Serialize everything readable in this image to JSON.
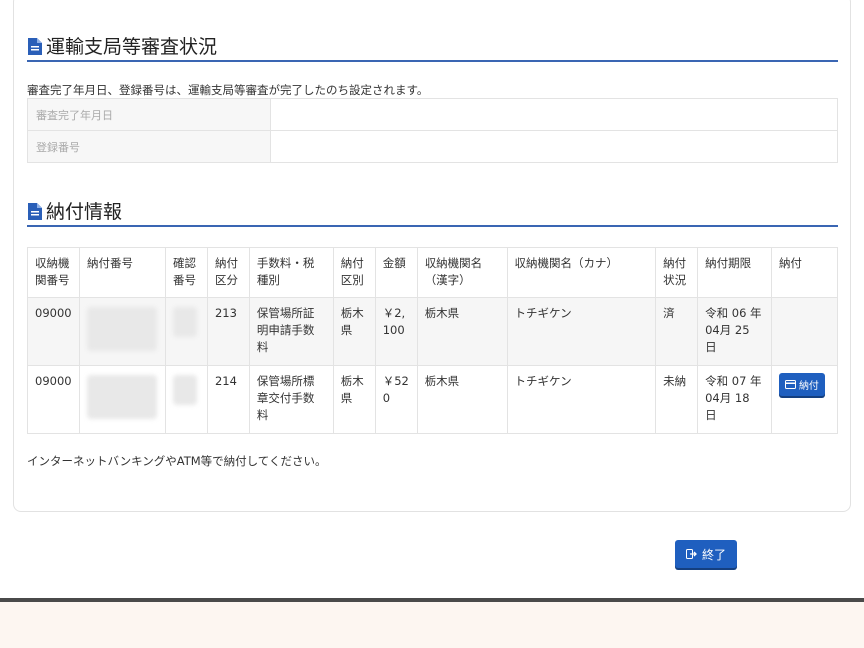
{
  "sections": {
    "review": {
      "title": "運輸支局等審査状況",
      "note": "審査完了年月日、登録番号は、運輸支局等審査が完了したのち設定されます。",
      "rows": [
        {
          "label": "審査完了年月日",
          "value": ""
        },
        {
          "label": "登録番号",
          "value": ""
        }
      ]
    },
    "payment": {
      "title": "納付情報",
      "headers": [
        "収納機関番号",
        "納付番号",
        "確認番号",
        "納付区分",
        "手数料・税種別",
        "納付区別",
        "金額",
        "収納機関名（漢字）",
        "収納機関名（カナ）",
        "納付状況",
        "納付期限",
        "納付"
      ],
      "rows": [
        {
          "agency_no": "09000",
          "category": "213",
          "fee_type": "保管場所証明申請手数料",
          "district": "栃木県",
          "amount": "￥2,100",
          "agency_kanji": "栃木県",
          "agency_kana": "トチギケン",
          "status": "済",
          "deadline": "令和 06 年 04月 25 日"
        },
        {
          "agency_no": "09000",
          "category": "214",
          "fee_type": "保管場所標章交付手数料",
          "district": "栃木県",
          "amount": "￥520",
          "agency_kanji": "栃木県",
          "agency_kana": "トチギケン",
          "status": "未納",
          "deadline": "令和 07 年 04月 18 日",
          "pay_button": "納付"
        }
      ],
      "footer_note": "インターネットバンキングやATM等で納付してください。"
    }
  },
  "actions": {
    "end_label": "終了"
  },
  "colors": {
    "primary": "#1f5fbf",
    "section_line": "#3a66b3"
  }
}
